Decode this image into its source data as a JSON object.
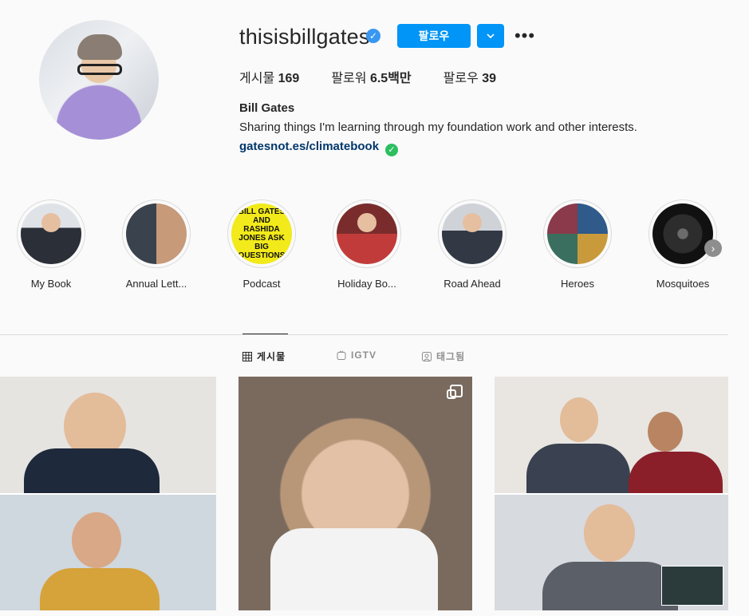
{
  "profile": {
    "username": "thisisbillgates",
    "follow_label": "팔로우",
    "more_icon": "more-horizontal-icon",
    "stats": {
      "posts_label": "게시물",
      "posts_value": "169",
      "followers_label": "팔로워",
      "followers_value": "6.5백만",
      "following_label": "팔로우",
      "following_value": "39"
    },
    "name": "Bill Gates",
    "bio": "Sharing things I'm learning through my foundation work and other interests.",
    "link": "gatesnot.es/climatebook"
  },
  "highlights": [
    {
      "label": "My Book"
    },
    {
      "label": "Annual Lett..."
    },
    {
      "label": "Podcast",
      "cover_text": "BILL GATES AND RASHIDA JONES ASK BIG QUESTIONS"
    },
    {
      "label": "Holiday Bo..."
    },
    {
      "label": "Road Ahead"
    },
    {
      "label": "Heroes"
    },
    {
      "label": "Mosquitoes"
    }
  ],
  "tabs": [
    {
      "label": "게시물",
      "icon": "grid-icon",
      "active": true
    },
    {
      "label": "IGTV",
      "icon": "igtv-icon",
      "active": false
    },
    {
      "label": "태그됨",
      "icon": "tagged-icon",
      "active": false
    }
  ],
  "colors": {
    "accent": "#0095f6",
    "link": "#00376b",
    "verified": "#3897f0",
    "text": "#262626",
    "muted": "#8e8e8e",
    "background": "#fafafa"
  }
}
